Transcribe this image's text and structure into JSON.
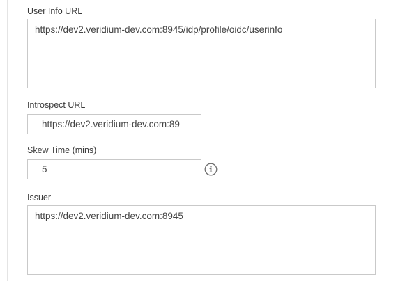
{
  "user_info_url": {
    "label": "User Info URL",
    "value": "https://dev2.veridium-dev.com:8945/idp/profile/oidc/userinfo"
  },
  "introspect_url": {
    "label": "Introspect URL",
    "value": "https://dev2.veridium-dev.com:89"
  },
  "skew_time": {
    "label": "Skew Time (mins)",
    "value": "5",
    "info_icon": "info-circle-icon"
  },
  "issuer": {
    "label": "Issuer",
    "value": "https://dev2.veridium-dev.com:8945"
  }
}
